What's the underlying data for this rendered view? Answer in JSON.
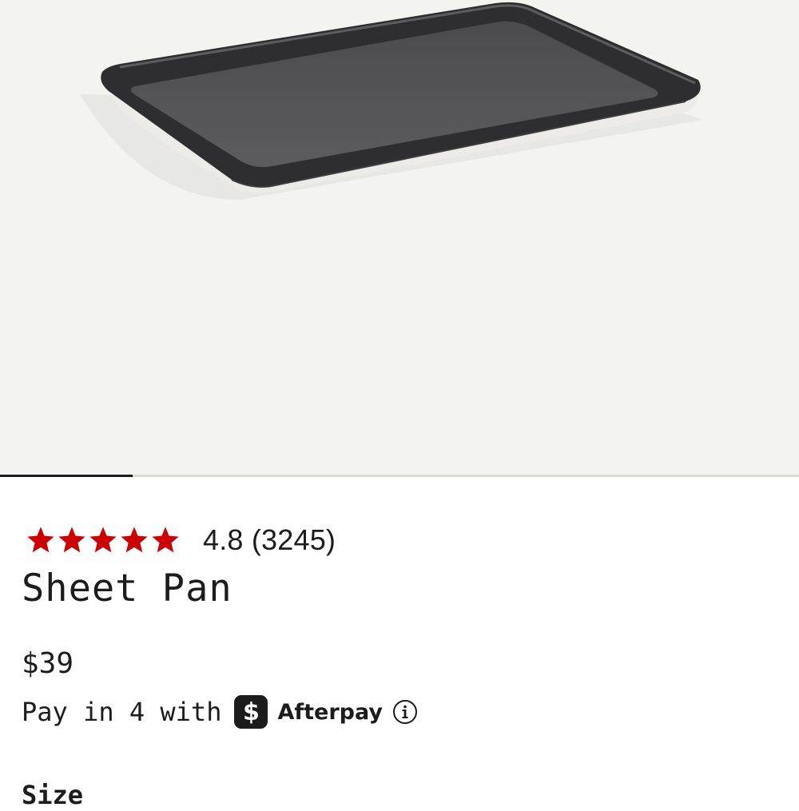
{
  "product": {
    "image_alt": "Sheet Pan",
    "gallery_progress": 0.166,
    "rating": {
      "stars": 5,
      "text": "4.8 (3245)",
      "star_color": "#cc0000"
    },
    "title": "Sheet Pan",
    "price": "$39",
    "financing": {
      "text": "Pay in 4 with",
      "logo_glyph": "$",
      "brand": "Afterpay",
      "info_icon": "info-circle-icon"
    },
    "size_label": "Size"
  },
  "colors": {
    "hero_background": "#f3f4ef",
    "text": "#1c1c1c",
    "accent_star": "#cc0000"
  }
}
